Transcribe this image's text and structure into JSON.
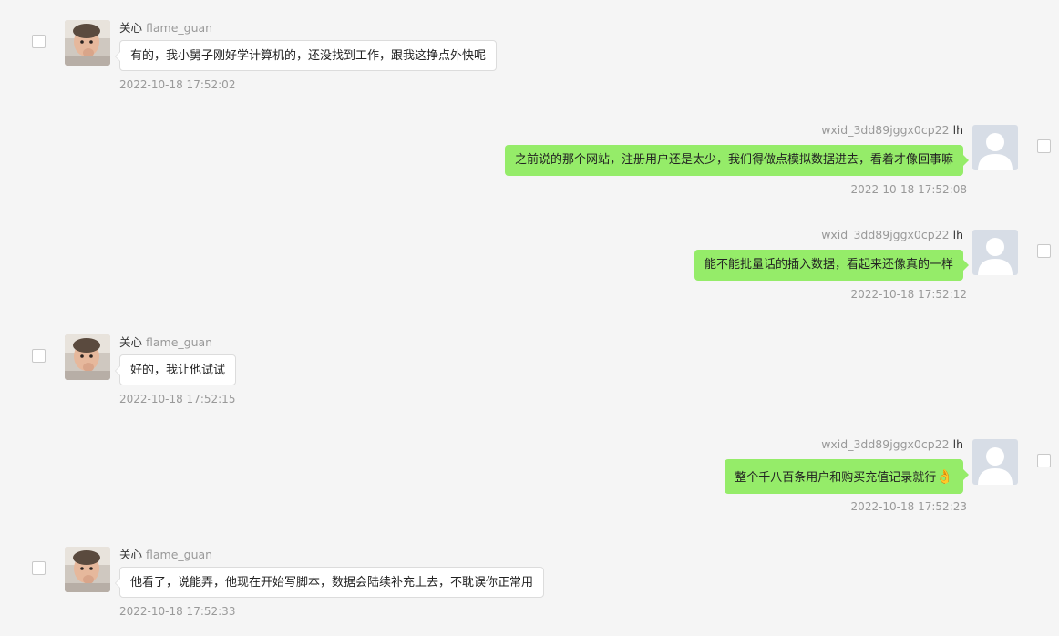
{
  "messages": [
    {
      "direction": "in",
      "sender_remark": "关心",
      "sender_account": "flame_guan",
      "text": "有的，我小舅子刚好学计算机的，还没找到工作，跟我这挣点外快呢",
      "time": "2022-10-18 17:52:02"
    },
    {
      "direction": "out",
      "sender_account": "wxid_3dd89jggx0cp22",
      "sender_remark": "lh",
      "text": "之前说的那个网站，注册用户还是太少，我们得做点模拟数据进去，看着才像回事嘛",
      "time": "2022-10-18 17:52:08"
    },
    {
      "direction": "out",
      "sender_account": "wxid_3dd89jggx0cp22",
      "sender_remark": "lh",
      "text": "能不能批量话的插入数据，看起来还像真的一样",
      "time": "2022-10-18 17:52:12"
    },
    {
      "direction": "in",
      "sender_remark": "关心",
      "sender_account": "flame_guan",
      "text": "好的，我让他试试",
      "time": "2022-10-18 17:52:15"
    },
    {
      "direction": "out",
      "sender_account": "wxid_3dd89jggx0cp22",
      "sender_remark": "lh",
      "text": "整个千八百条用户和购买充值记录就行",
      "emoji": "👌",
      "time": "2022-10-18 17:52:23"
    },
    {
      "direction": "in",
      "sender_remark": "关心",
      "sender_account": "flame_guan",
      "text": "他看了，说能弄，他现在开始写脚本，数据会陆续补充上去，不耽误你正常用",
      "time": "2022-10-18 17:52:33"
    }
  ]
}
